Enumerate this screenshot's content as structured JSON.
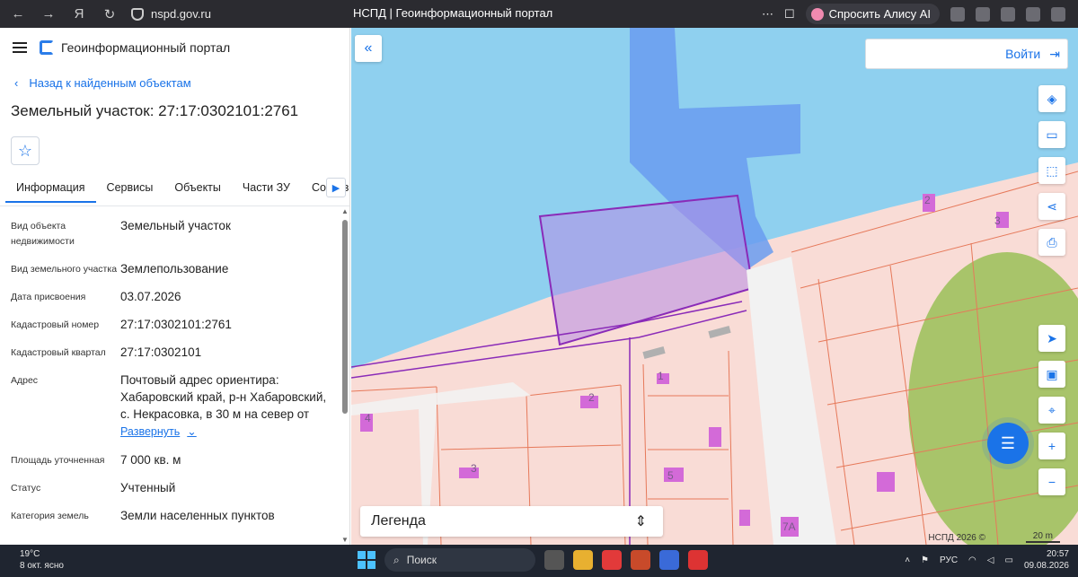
{
  "browser": {
    "url": "nspd.gov.ru",
    "tab_title": "НСПД | Геоинформационный портал",
    "alice_label": "Спросить Алису AI"
  },
  "sidebar": {
    "portal_title": "Геоинформационный портал",
    "back_label": "Назад к найденным объектам",
    "page_title": "Земельный участок: 27:17:0302101:2761",
    "tabs": [
      {
        "label": "Информация"
      },
      {
        "label": "Сервисы"
      },
      {
        "label": "Объекты"
      },
      {
        "label": "Части ЗУ"
      },
      {
        "label": "Состав"
      }
    ],
    "properties": [
      {
        "label": "Вид объекта недвижимости",
        "value": "Земельный участок"
      },
      {
        "label": "Вид земельного участка",
        "value": "Землепользование"
      },
      {
        "label": "Дата присвоения",
        "value": "03.07.2026"
      },
      {
        "label": "Кадастровый номер",
        "value": "27:17:0302101:2761"
      },
      {
        "label": "Кадастровый квартал",
        "value": "27:17:0302101"
      },
      {
        "label": "Адрес",
        "value": "Почтовый адрес ориентира: Хабаровский край, р-н Хабаровский, с. Некрасовка, в 30 м на север от"
      },
      {
        "label": "Площадь уточненная",
        "value": "7 000 кв. м"
      },
      {
        "label": "Статус",
        "value": "Учтенный"
      },
      {
        "label": "Категория земель",
        "value": "Земли населенных пунктов"
      }
    ],
    "expand_label": "Развернуть"
  },
  "map": {
    "login_label": "Войти",
    "legend_label": "Легенда",
    "copyright": "НСПД 2026 ©",
    "scale": "20 m",
    "parcel_numbers": [
      "1",
      "2",
      "3",
      "5",
      "7А",
      "4",
      "3",
      "2"
    ]
  },
  "taskbar": {
    "temperature": "19°C",
    "weather": "8 окт. ясно",
    "search_label": "Поиск",
    "lang": "РУС",
    "time": "20:57",
    "date": "09.08.2026"
  }
}
